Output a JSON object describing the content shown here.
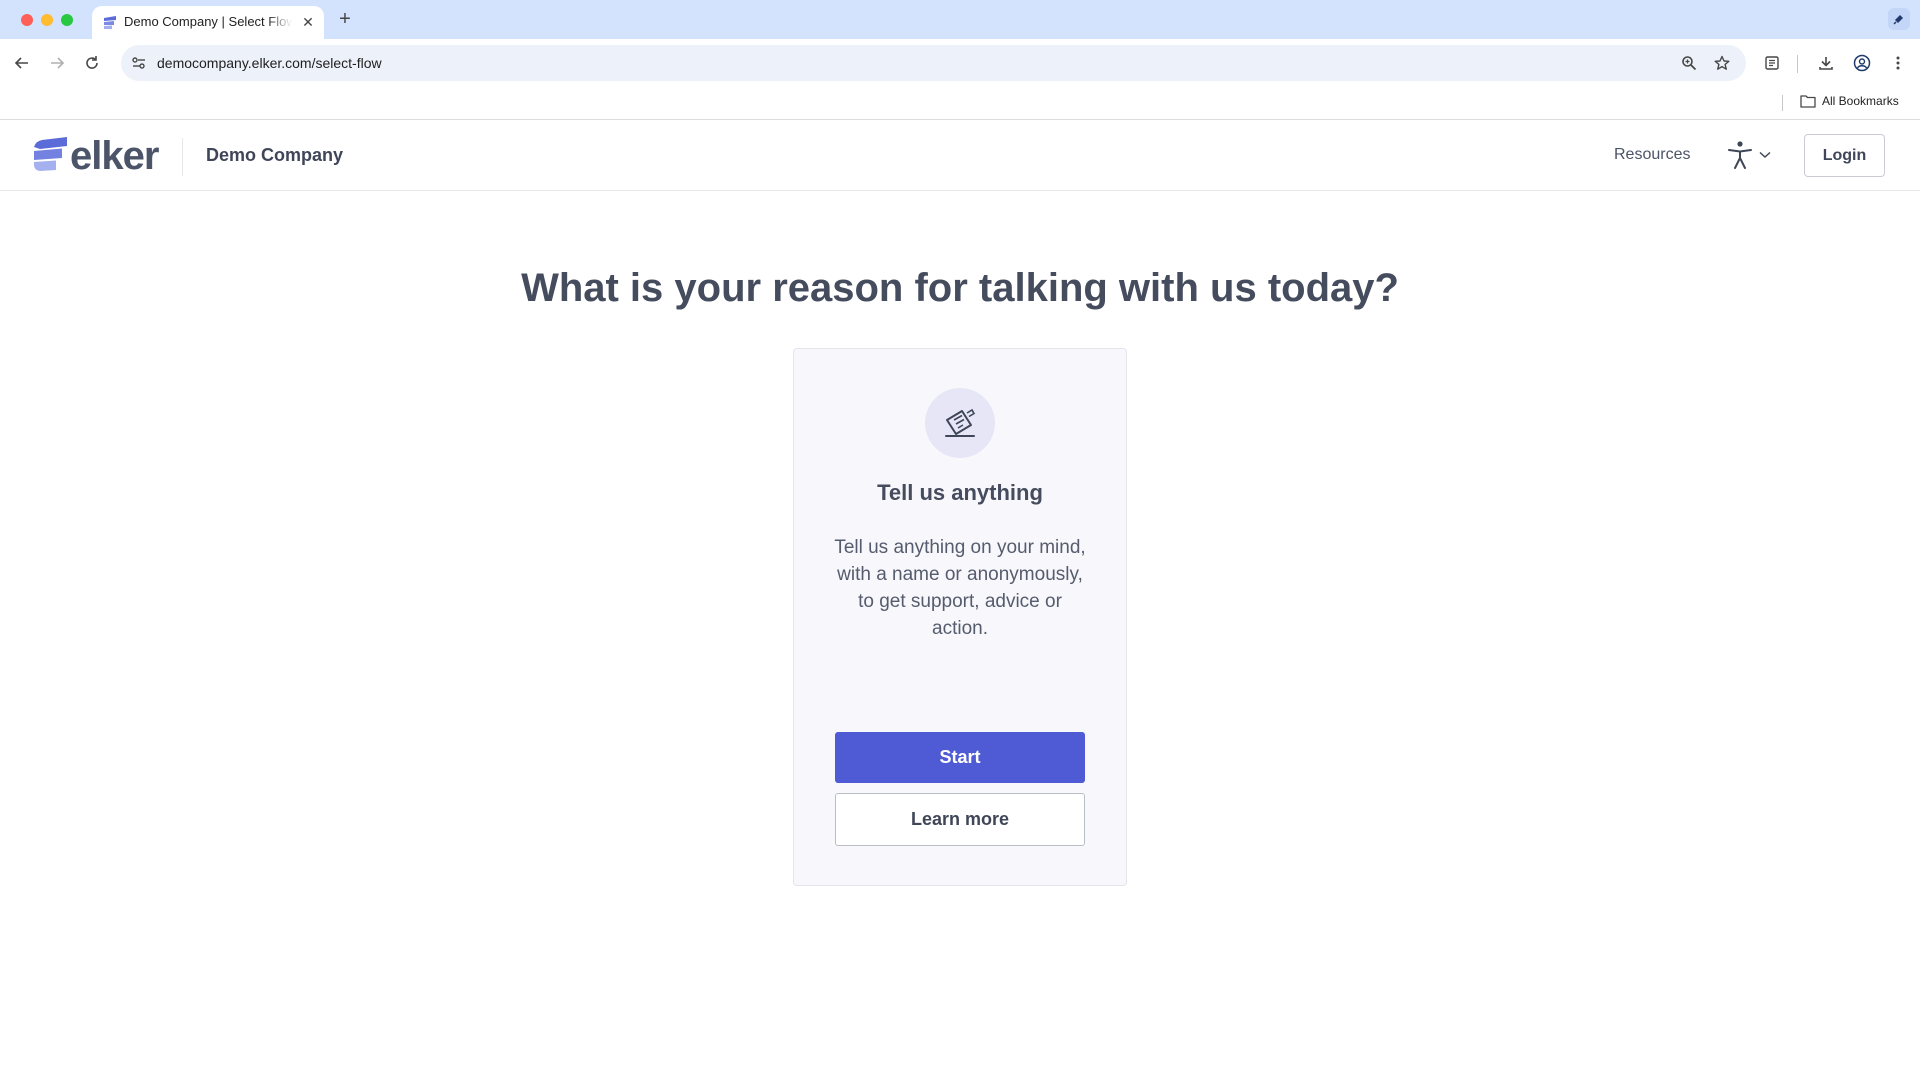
{
  "browser": {
    "tab_title": "Demo Company | Select Flow",
    "tab_close": "✕",
    "new_tab": "+",
    "url": "democompany.elker.com/select-flow",
    "bookmarks_label": "All Bookmarks"
  },
  "header": {
    "logo_text": "elker",
    "company_name": "Demo Company",
    "resources_label": "Resources",
    "login_label": "Login"
  },
  "main": {
    "heading": "What is your reason for talking with us today?",
    "card": {
      "title": "Tell us anything",
      "description": "Tell us anything on your mind, with a name or anonymously, to get support, advice or action.",
      "start_label": "Start",
      "learn_more_label": "Learn more"
    }
  },
  "colors": {
    "accent": "#4f5bd5",
    "text_dark": "#454c5e",
    "card_bg": "#f8f8fc",
    "icon_bg": "#e6e6f7",
    "tabbar_bg": "#d3e3fd"
  }
}
